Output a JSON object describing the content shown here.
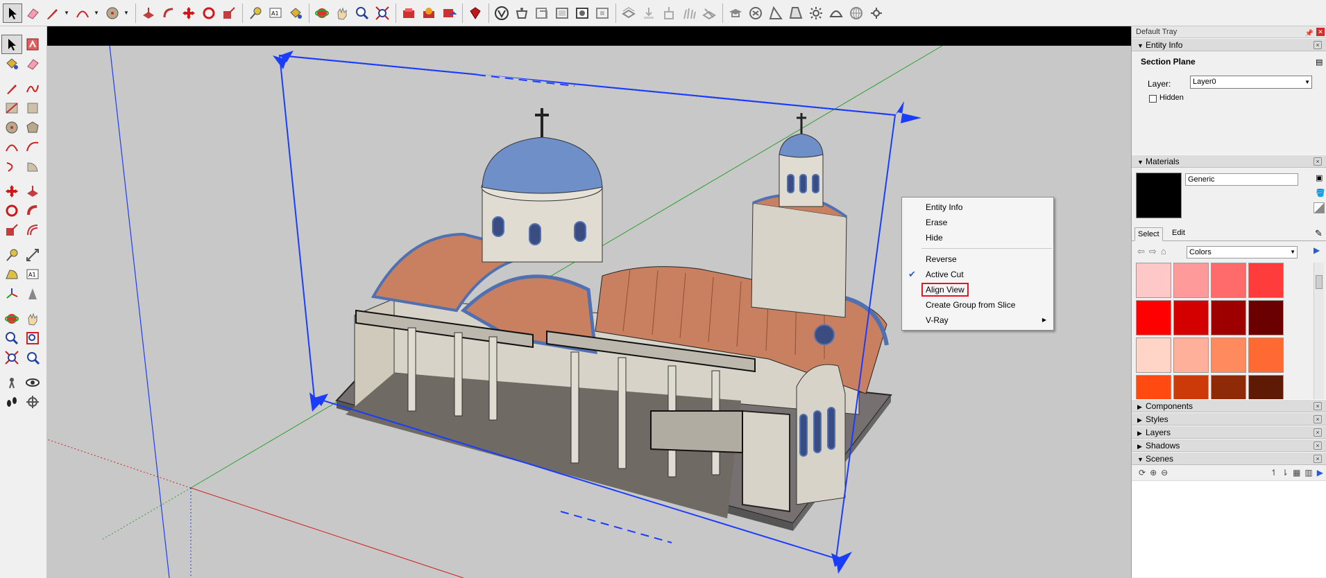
{
  "toolbar": {
    "top_icons": [
      "select-arrow-icon",
      "eraser-icon",
      "pencil-icon",
      "arc-icon",
      "circle-icon",
      "push-pull-icon",
      "follow-me-icon",
      "move-icon",
      "rotate-icon",
      "scale-icon",
      "tape-measure-icon",
      "text-icon",
      "paint-bucket-icon",
      "orbit-icon",
      "pan-icon",
      "zoom-icon",
      "zoom-extents-icon",
      "warehouse-get-models-icon",
      "warehouse-share-icon",
      "warehouse-components-icon",
      "extension-warehouse-icon",
      "vray-icon",
      "vray-material-editor-icon",
      "vray-options-icon",
      "frame-buffer-icon",
      "render-icon",
      "render-interactive-icon",
      "batch-render-icon",
      "sun-light-icon",
      "spot-light-icon",
      "ies-light-icon",
      "omni-light-icon",
      "dome-light-icon",
      "sphere-icon",
      "proxy-icon",
      "fur-icon",
      "plane-icon",
      "grad-cap-icon",
      "sphere-light-icon",
      "cone-light-icon",
      "spot-cone-icon",
      "sun-icon",
      "dome-icon",
      "globe-icon",
      "omni-gear-icon"
    ]
  },
  "left_toolbar": {
    "icons": [
      "select-icon",
      "make-component-icon",
      "paint-bucket-icon",
      "eraser-icon",
      "line-icon",
      "freehand-icon",
      "rectangle-icon",
      "rotated-rectangle-icon",
      "circle-icon",
      "polygon-icon",
      "arc-icon",
      "two-point-arc-icon",
      "three-point-arc-icon",
      "pie-icon",
      "move-icon",
      "push-pull-icon",
      "rotate-icon",
      "follow-me-icon",
      "scale-icon",
      "offset-icon",
      "tape-measure-icon",
      "dimension-icon",
      "protractor-icon",
      "text-icon",
      "axes-icon",
      "3d-text-icon",
      "orbit-icon",
      "pan-icon",
      "zoom-icon",
      "zoom-window-icon",
      "zoom-extents-icon",
      "previous-view-icon",
      "position-camera-icon",
      "look-around-icon",
      "walk-icon",
      "section-plane-icon"
    ]
  },
  "context_menu": {
    "items": [
      {
        "label": "Entity Info"
      },
      {
        "label": "Erase"
      },
      {
        "label": "Hide"
      },
      {
        "label": "Reverse"
      },
      {
        "label": "Active Cut",
        "checked": true
      },
      {
        "label": "Align View",
        "highlighted": true
      },
      {
        "label": "Create Group from Slice"
      },
      {
        "label": "V-Ray",
        "submenu": true
      }
    ]
  },
  "tray": {
    "title": "Default Tray",
    "entity_info": {
      "header": "Entity Info",
      "entity_type": "Section Plane",
      "layer_label": "Layer:",
      "layer_value": "Layer0",
      "hidden_label": "Hidden",
      "hidden_checked": false
    },
    "materials": {
      "header": "Materials",
      "current_name": "Generic",
      "current_color": "#000000",
      "tab_select": "Select",
      "tab_edit": "Edit",
      "collection": "Colors",
      "swatches": [
        "#ffc8c8",
        "#ff9a9a",
        "#ff6b6b",
        "#ff3c3c",
        "#ff0000",
        "#d40000",
        "#9e0000",
        "#6b0000",
        "#ffd5c8",
        "#ffb09a",
        "#ff8a5e",
        "#ff6a32",
        "#ff4a12",
        "#cc3a0a",
        "#8e2a08",
        "#5e1a04"
      ]
    },
    "collapsed_panels": [
      "Components",
      "Styles",
      "Layers",
      "Shadows"
    ],
    "scenes": {
      "header": "Scenes"
    }
  },
  "colors": {
    "section_plane": "#1a3cff",
    "viewport_bg": "#c8c8c8",
    "highlight_box": "#e8141b",
    "dome_blue": "#6e8fc8",
    "roof_terracotta": "#c98060"
  }
}
